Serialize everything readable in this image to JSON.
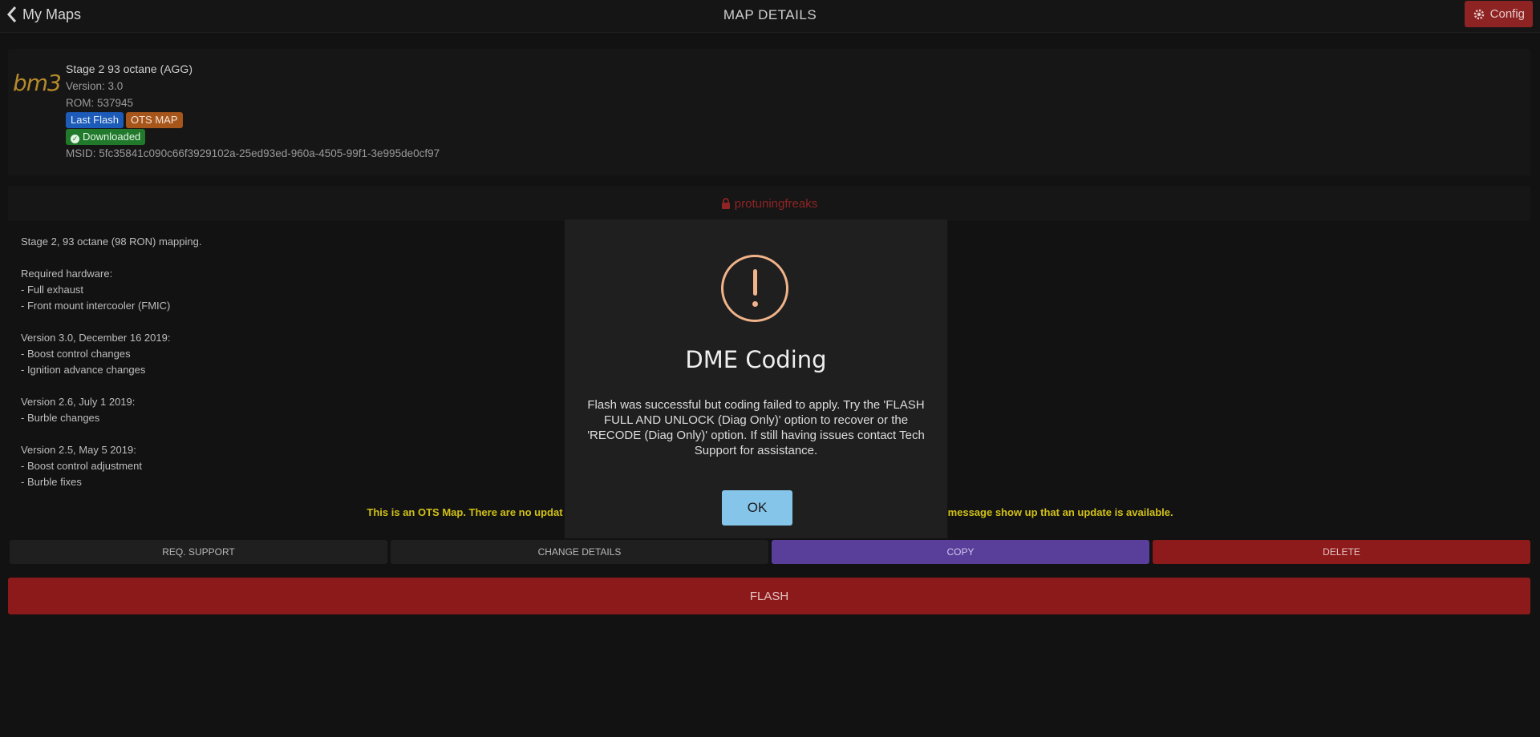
{
  "header": {
    "back_label": "My Maps",
    "title": "MAP DETAILS",
    "config_label": "Config"
  },
  "map": {
    "logo": "bm3",
    "name": "Stage 2 93 octane (AGG)",
    "version": "Version: 3.0",
    "rom": "ROM: 537945",
    "badges": {
      "last_flash": "Last Flash",
      "ots_map": "OTS MAP",
      "downloaded": "Downloaded"
    },
    "msid": "MSID: 5fc35841c090c66f3929102a-25ed93ed-960a-4505-99f1-3e995de0cf97"
  },
  "owner": "protuningfreaks",
  "description": "Stage 2, 93 octane (98 RON) mapping.\n\nRequired hardware:\n- Full exhaust\n- Front mount intercooler (FMIC)\n\nVersion 3.0, December 16 2019:\n- Boost control changes\n- Ignition advance changes\n\nVersion 2.6, July 1 2019:\n- Burble changes\n\nVersion 2.5, May 5 2019:\n- Boost control adjustment\n- Burble fixes",
  "notice": {
    "left": "This is an OTS Map. There are no updat",
    "right": "message show up that an update is available."
  },
  "actions": {
    "req_support": "REQ. SUPPORT",
    "change_details": "CHANGE DETAILS",
    "copy": "COPY",
    "delete": "DELETE"
  },
  "flash_label": "FLASH",
  "modal": {
    "title": "DME Coding",
    "message": "Flash was successful but coding failed to apply. Try the 'FLASH FULL AND UNLOCK (Diag Only)' option to recover or the 'RECODE (Diag Only)' option. If still having issues contact Tech Support for assistance.",
    "ok_label": "OK"
  },
  "colors": {
    "background": "#121212",
    "config": "#8e2323",
    "flash": "#8d1a1a",
    "copy": "#5a3f9a",
    "notice": "#d1c016",
    "warning": "#f0b38a",
    "ok_button": "#86c5ea"
  },
  "icons": [
    "chevron-left-icon",
    "gear-icon",
    "lock-icon",
    "check-circle-icon",
    "warning-circle-icon"
  ]
}
